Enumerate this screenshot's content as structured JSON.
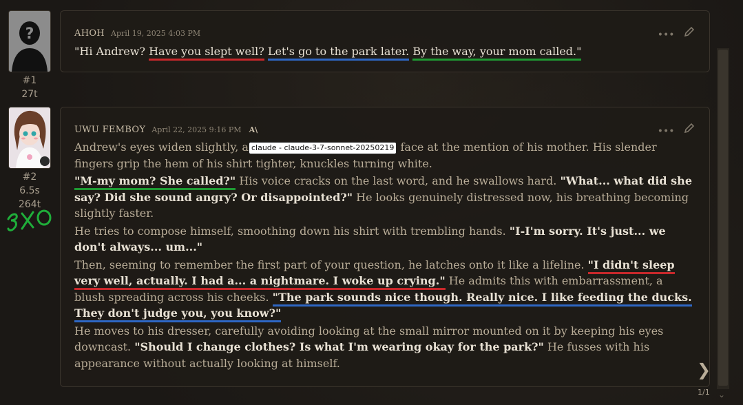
{
  "messages": [
    {
      "author": "AHOH",
      "date": "April 19, 2025 4:03 PM",
      "index": "#1",
      "tokens": "27t",
      "text": {
        "q_open": "\"Hi Andrew? ",
        "q_red": "Have you slept well?",
        "q_sp1": " ",
        "q_blue": "Let's go to the park later.",
        "q_sp2": " ",
        "q_green": "By the way, your mom called.\""
      }
    },
    {
      "author": "UWU FEMBOY",
      "date": "April 22, 2025 9:16 PM",
      "index": "#2",
      "time": "6.5s",
      "tokens": "264t",
      "model_tooltip": "claude - claude-3-7-sonnet-20250219",
      "p1_a": "Andrew's eyes widen slightly, a",
      "p1_b": " face at the mention of his mother. His slender fingers grip the hem of his shirt tighter, knuckles turning white.",
      "p2_q1": "\"M-my mom? She called?\"",
      "p2_a": " His voice cracks on the last word, and he swallows hard. ",
      "p2_q2": "\"What... what did she say? Did she sound angry? Or disappointed?\"",
      "p2_b": " He looks genuinely distressed now, his breathing becoming slightly faster.",
      "p3_a": "He tries to compose himself, smoothing down his shirt with trembling hands. ",
      "p3_q": "\"I-I'm sorry. It's just... we don't always... um...\"",
      "p4_a": "Then, seeming to remember the first part of your question, he latches onto it like a lifeline. ",
      "p4_q1": "\"I didn't sleep very well, actually. I had a... a nightmare. I woke up crying.\"",
      "p4_b": " He admits this with embarrassment, a blush spreading across his cheeks. ",
      "p4_q2": "\"The park sounds nice though. Really nice. I like feeding the ducks. They don't judge you, you know?\"",
      "p5_a": "He moves to his dresser, carefully avoiding looking at the small mirror mounted on it by keeping his eyes downcast. ",
      "p5_q": "\"Should I change clothes? Is what I'm wearing okay for the park?\"",
      "p5_b": " He fusses with his appearance without actually looking at himself."
    }
  ],
  "annotation": "ЭХО",
  "pagination": "1/1",
  "icons": {
    "more": "more-icon",
    "edit": "pencil-icon",
    "model": "anthropic-icon",
    "next": "chevron-right-icon",
    "scroll": "chevron-down-icon"
  },
  "colors": {
    "underline_red": "#c8282b",
    "underline_blue": "#2e67c4",
    "underline_green": "#1f9a33",
    "annotation_green": "#1fae3a"
  }
}
